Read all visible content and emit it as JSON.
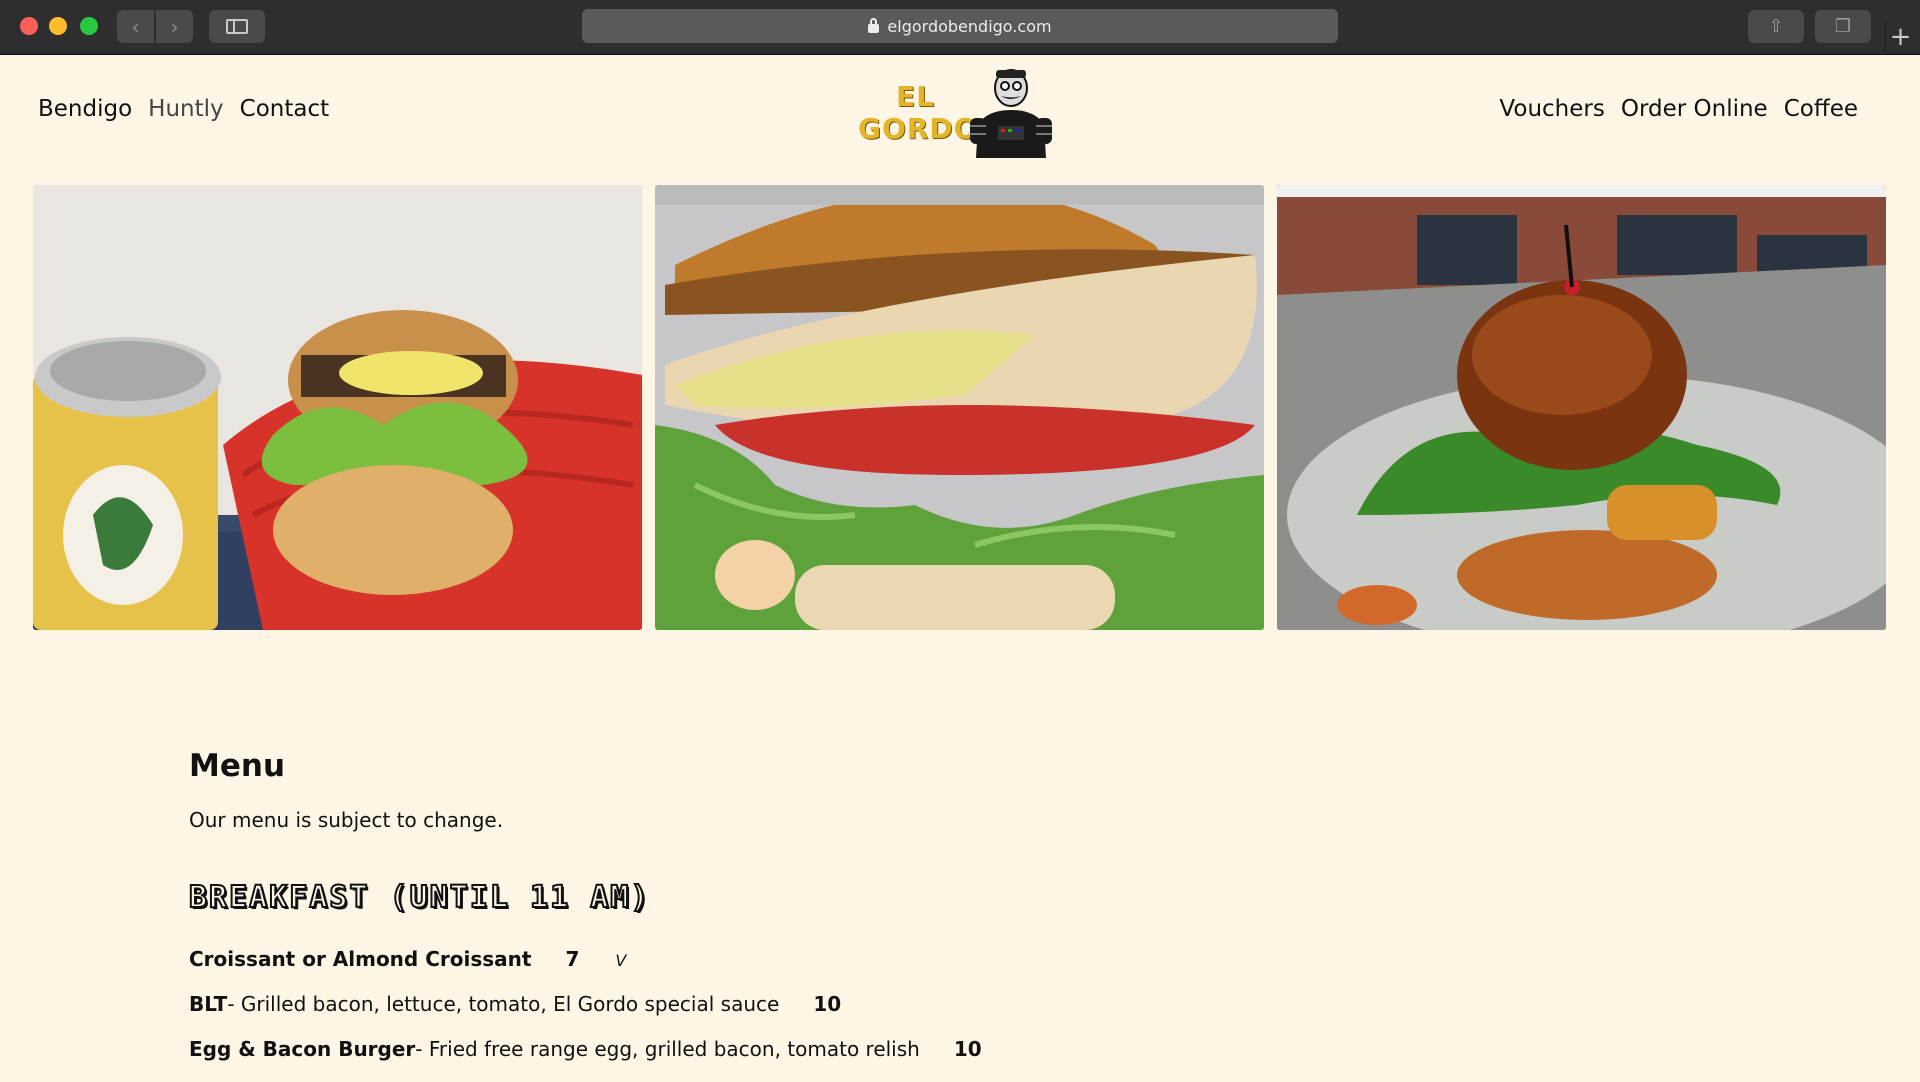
{
  "browser": {
    "url": "elgordobendigo.com",
    "back_icon": "chevron-left-icon",
    "forward_icon": "chevron-right-icon",
    "share_icon": "share-icon",
    "tabs_icon": "tabs-icon",
    "new_tab_label": "+"
  },
  "header": {
    "nav_left": [
      "Bendigo",
      "Huntly",
      "Contact"
    ],
    "nav_right": [
      "Vouchers",
      "Order Online",
      "Coffee"
    ],
    "logo": {
      "line1": "EL",
      "line2": "GORDO"
    }
  },
  "menu": {
    "title": "Menu",
    "note": "Our menu is subject to change.",
    "section": "BREAKFAST (UNTIL 11 AM)",
    "items": [
      {
        "name": "Croissant or Almond Croissant",
        "desc": "",
        "price": "7",
        "tag": "V"
      },
      {
        "name": "BLT",
        "desc": " - Grilled bacon, lettuce, tomato, El Gordo special sauce",
        "price": "10",
        "tag": ""
      },
      {
        "name": "Egg & Bacon Burger",
        "desc": " - Fried free range egg, grilled bacon, tomato relish",
        "price": "10",
        "tag": ""
      }
    ]
  },
  "colors": {
    "page_bg": "#fdf6e7",
    "logo_gold": "#e4b528",
    "chrome_bg": "#2e2e30"
  }
}
